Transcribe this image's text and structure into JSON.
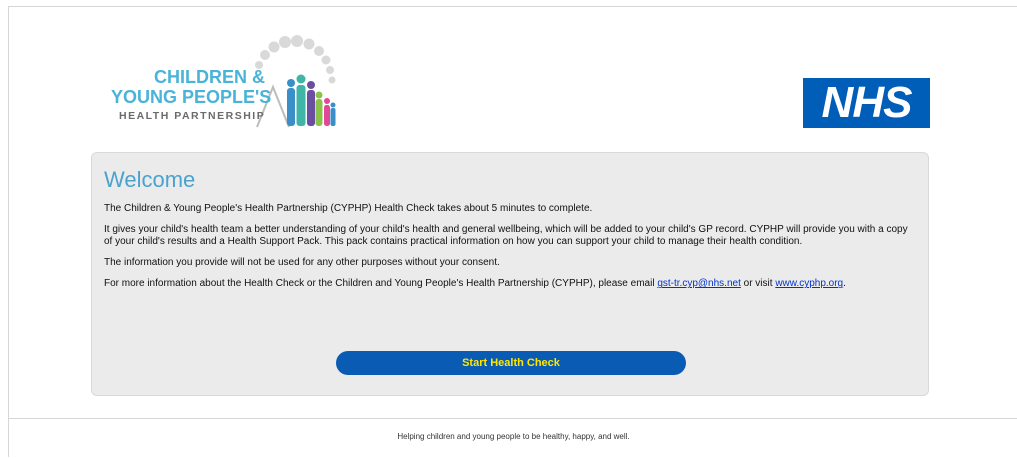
{
  "header": {
    "cyphp_logo": {
      "line1": "CHILDREN &",
      "line2": "YOUNG PEOPLE'S",
      "line3": "HEALTH PARTNERSHIP",
      "text_color": "#4ab3d8",
      "subtext_color": "#6b6b6b"
    },
    "nhs_logo": {
      "text": "NHS",
      "background": "#005eb8"
    }
  },
  "welcome": {
    "title": "Welcome",
    "paragraph1": "The Children & Young People's Health Partnership (CYPHP) Health Check takes about 5 minutes to complete.",
    "paragraph2": "It gives your child's health team a better understanding of your child's health and general wellbeing, which will be added to your child's GP record. CYPHP will provide you with a copy of your child's results and a Health Support Pack. This pack contains practical information on how you can support your child to manage their health condition.",
    "paragraph3": "The information you provide will not be used for any other purposes without your consent.",
    "paragraph4_prefix": "For more information about the Health Check or the Children and Young People's Health Partnership (CYPHP), please email ",
    "email_link": "gst-tr.cyp@nhs.net",
    "paragraph4_middle": " or visit ",
    "website_link": "www.cyphp.org",
    "paragraph4_suffix": ".",
    "start_button": "Start Health Check"
  },
  "footer": {
    "tagline": "Helping children and young people to be healthy, happy, and well."
  },
  "colors": {
    "title_blue": "#4aa3cf",
    "button_blue": "#0a5bb3",
    "button_text": "#ffe800",
    "card_background": "#ebebeb",
    "link": "#0033cc"
  }
}
